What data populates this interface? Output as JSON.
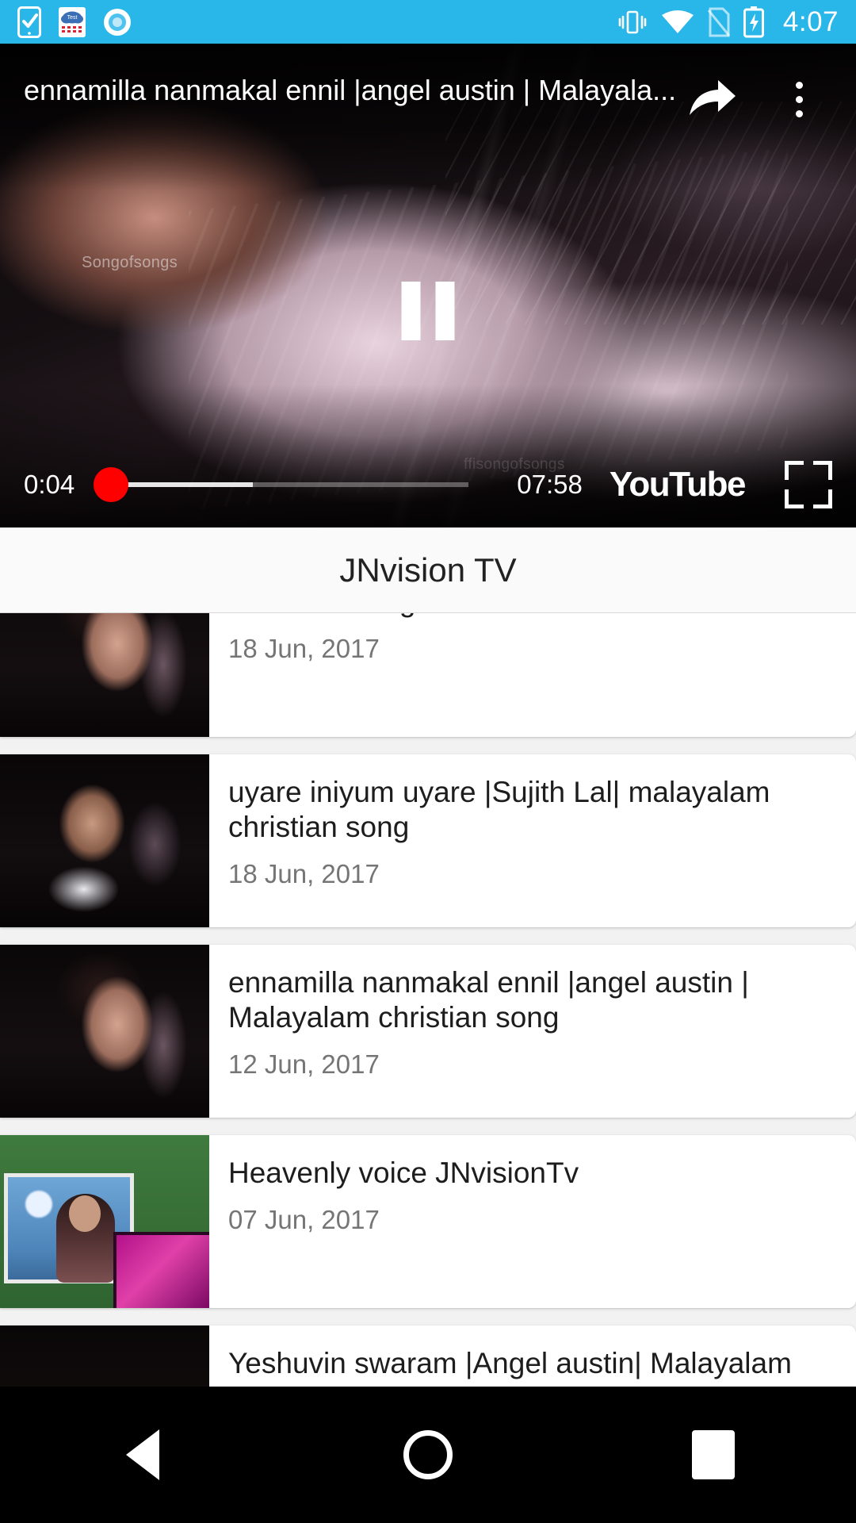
{
  "status_bar": {
    "background_color": "#29b6e8",
    "clock": "4:07",
    "left_icons": [
      "phone-check-icon",
      "weather-test-calendar-icon",
      "circle-record-icon"
    ],
    "right_icons": [
      "vibrate-icon",
      "wifi-icon",
      "sim-card-icon",
      "battery-charging-icon"
    ]
  },
  "player": {
    "title": "ennamilla nanmakal ennil  |angel austin | Malayala...",
    "share_icon": "share-arrow-icon",
    "more_icon": "more-vertical-icon",
    "playback_state": "paused",
    "pause_icon": "pause-icon",
    "current_time": "0:04",
    "total_time": "07:58",
    "progress_percent": 2.2,
    "buffered_percent": 41,
    "brand": "YouTube",
    "brand_color": "#ffffff",
    "accent_color": "#ff0000",
    "fullscreen_icon": "fullscreen-icon",
    "watermark": "Songofsongs",
    "watermark2": "ffisongofsongs"
  },
  "channel": {
    "title": "JNvision TV"
  },
  "videos": [
    {
      "title": "oru nimishavum |Angel austin| Malayalam Christian songs",
      "date": "18 Jun, 2017",
      "thumb": "th-singer-f",
      "clipped": true
    },
    {
      "title": "uyare iniyum uyare |Sujith Lal| malayalam christian song",
      "date": "18 Jun, 2017",
      "thumb": "th-singer-m",
      "clipped": false
    },
    {
      "title": "ennamilla nanmakal ennil  |angel austin | Malayalam christian song",
      "date": "12 Jun, 2017",
      "thumb": "th-singer-f",
      "clipped": false
    },
    {
      "title": "Heavenly voice JNvisionTv",
      "date": "07 Jun, 2017",
      "thumb": "th-studio",
      "clipped": false
    },
    {
      "title": "Yeshuvin swaram  |Angel austin| Malayalam",
      "date": "",
      "thumb": "th-face-top",
      "clipped": false
    }
  ],
  "nav_bar": {
    "background_color": "#000000",
    "back_label": "Back",
    "home_label": "Home",
    "recents_label": "Recents"
  }
}
